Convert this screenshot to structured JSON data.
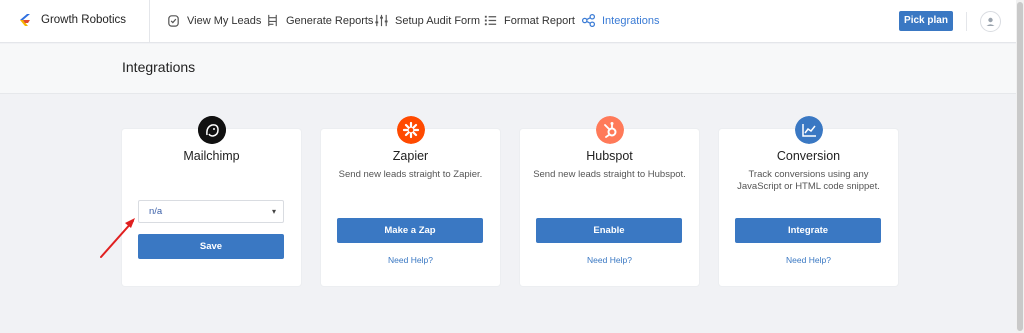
{
  "brand": {
    "name": "Growth Robotics"
  },
  "nav": {
    "items": [
      {
        "label": "View My Leads",
        "icon": "clipboard-check-icon"
      },
      {
        "label": "Generate Reports",
        "icon": "report-icon"
      },
      {
        "label": "Setup Audit Form",
        "icon": "sliders-icon"
      },
      {
        "label": "Format Report",
        "icon": "list-icon"
      },
      {
        "label": "Integrations",
        "icon": "integrations-icon",
        "active": true
      }
    ]
  },
  "header": {
    "pick_plan": "Pick plan"
  },
  "page": {
    "title": "Integrations"
  },
  "colors": {
    "accent": "#3a78c3",
    "active_nav": "#3a7bd5",
    "zapier": "#ff4a00",
    "hubspot": "#ff7a59",
    "mailchimp": "#111111",
    "conversion": "#3a78c3",
    "annotation_arrow": "#e02020"
  },
  "cards": [
    {
      "title": "Mailchimp",
      "select_value": "n/a",
      "button": "Save",
      "icon": "mailchimp-icon"
    },
    {
      "title": "Zapier",
      "description": "Send new leads straight to Zapier.",
      "button": "Make a Zap",
      "help": "Need Help?",
      "icon": "zapier-icon"
    },
    {
      "title": "Hubspot",
      "description": "Send new leads straight to Hubspot.",
      "button": "Enable",
      "help": "Need Help?",
      "icon": "hubspot-icon"
    },
    {
      "title": "Conversion",
      "description": "Track conversions using any JavaScript or HTML code snippet.",
      "button": "Integrate",
      "help": "Need Help?",
      "icon": "chart-line-icon"
    }
  ]
}
